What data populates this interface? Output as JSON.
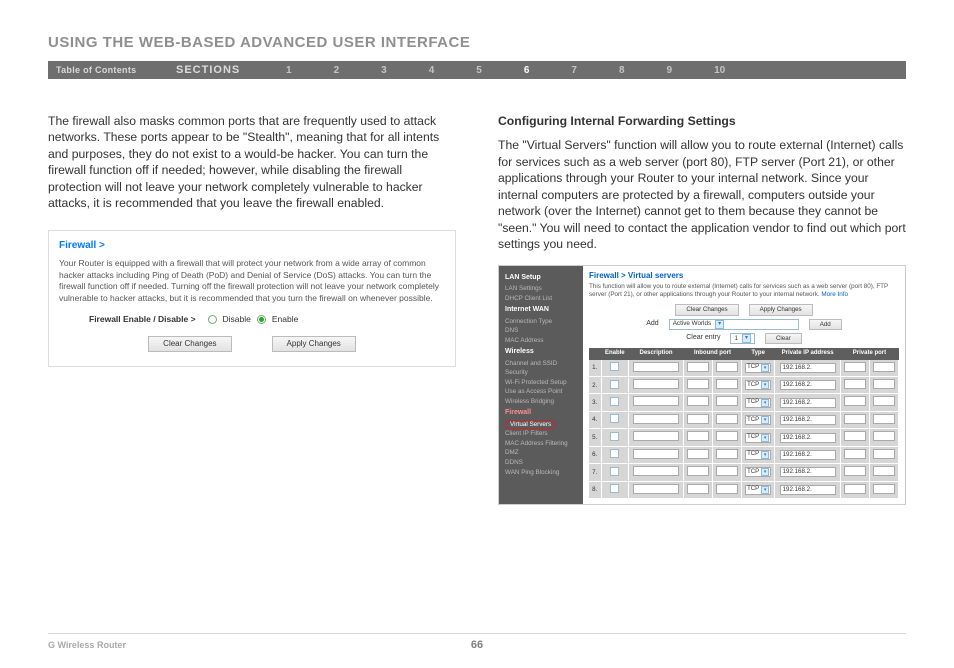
{
  "header": {
    "title": "USING THE WEB-BASED ADVANCED USER INTERFACE",
    "toc": "Table of Contents",
    "sections": "SECTIONS",
    "nums": [
      "1",
      "2",
      "3",
      "4",
      "5",
      "6",
      "7",
      "8",
      "9",
      "10"
    ],
    "active_index": 5
  },
  "left": {
    "para": "The firewall also masks common ports that are frequently used to attack networks. These ports appear to be \"Stealth\", meaning that for all intents and purposes, they do not exist to a would-be hacker. You can turn the firewall function off if needed; however, while disabling the firewall protection will not leave your network completely vulnerable to hacker attacks, it is recommended that you leave the firewall enabled.",
    "fw": {
      "crumb": "Firewall >",
      "body": "Your Router is equipped with a firewall that will protect your network from a wide array of common hacker attacks including Ping of Death (PoD) and Denial of Service (DoS) attacks. You can turn the firewall function off if needed. Turning off the firewall protection will not leave your network completely vulnerable to hacker attacks, but it is recommended that you turn the firewall on whenever possible.",
      "radio_label": "Firewall Enable / Disable >",
      "opt_disable": "Disable",
      "opt_enable": "Enable",
      "btn_clear": "Clear Changes",
      "btn_apply": "Apply Changes"
    }
  },
  "right": {
    "hdr": "Configuring Internal Forwarding Settings",
    "para": "The \"Virtual Servers\" function will allow you to route external (Internet) calls for services such as a web server (port 80), FTP server (Port 21), or other applications through your Router to your internal network. Since your internal computers are protected by a firewall, computers outside your network (over the Internet) cannot get to them because they cannot be \"seen.\" You will need to contact the application vendor to find out which port settings you need.",
    "vs": {
      "crumb": "Firewall > Virtual servers",
      "desc_a": "This function will allow you to route external (Internet) calls for services such as a web server (port 80), FTP server (Port 21), or other applications through your Router to your internal network. ",
      "desc_more": "More Info",
      "btn_clear": "Clear Changes",
      "btn_apply": "Apply Changes",
      "add_label": "Add",
      "add_select": "Active Worlds",
      "add_btn": "Add",
      "clear_label": "Clear entry",
      "clear_select": "1",
      "clear_btn": "Clear",
      "th": {
        "enable": "Enable",
        "desc": "Description",
        "inport": "Inbound port",
        "type": "Type",
        "pip": "Private IP address",
        "pport": "Private port"
      },
      "type_option": "TCP",
      "ip_prefix": "192.168.2.",
      "rows": [
        "1.",
        "2.",
        "3.",
        "4.",
        "5.",
        "6.",
        "7.",
        "8."
      ],
      "sidebar": {
        "cat_lan": "LAN Setup",
        "lan1": "LAN Settings",
        "lan2": "DHCP Client List",
        "cat_wan": "Internet WAN",
        "wan1": "Connection Type",
        "wan2": "DNS",
        "wan3": "MAC Address",
        "cat_wl": "Wireless",
        "wl1": "Channel and SSID",
        "wl2": "Security",
        "wl3": "Wi-Fi Protected Setup",
        "wl4": "Use as Access Point",
        "wl5": "Wireless Bridging",
        "cat_fw": "Firewall",
        "fw1": "Virtual Servers",
        "fw2": "Client IP Filters",
        "fw3": "MAC Address Filtering",
        "fw4": "DMZ",
        "fw5": "DDNS",
        "fw6": "WAN Ping Blocking"
      }
    }
  },
  "footer": {
    "product": "G Wireless Router",
    "page": "66"
  }
}
